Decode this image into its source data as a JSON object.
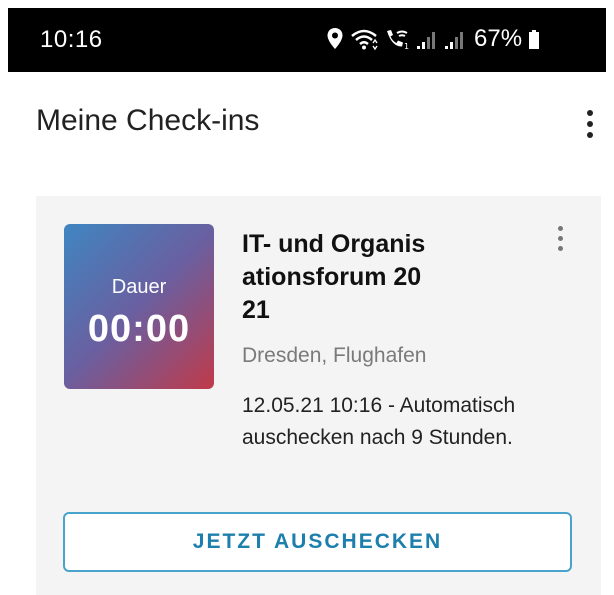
{
  "status_bar": {
    "time": "10:16",
    "battery": "67%",
    "icons": [
      "location-icon",
      "wifi-icon",
      "wifi-calling-icon",
      "signal-icon",
      "signal-icon",
      "battery-icon"
    ]
  },
  "header": {
    "title": "Meine Check-ins",
    "menu_icon": "more-vert-icon"
  },
  "checkin_card": {
    "timer": {
      "label": "Dauer",
      "value": "00:00"
    },
    "title": "IT- und Organisationsforum 2021",
    "location": "Dresden, Flughafen",
    "info": "12.05.21 10:16 - Automatisch auschecken nach 9 Stunden.",
    "menu_icon": "more-vert-icon",
    "checkout_label": "JETZT AUSCHECKEN"
  },
  "colors": {
    "status_bar_bg": "#000000",
    "card_bg": "#f4f4f4",
    "accent": "#1c7fac",
    "button_border": "#4aa3cc",
    "timer_gradient_start": "#3f86c1",
    "timer_gradient_end": "#c03a4a"
  }
}
